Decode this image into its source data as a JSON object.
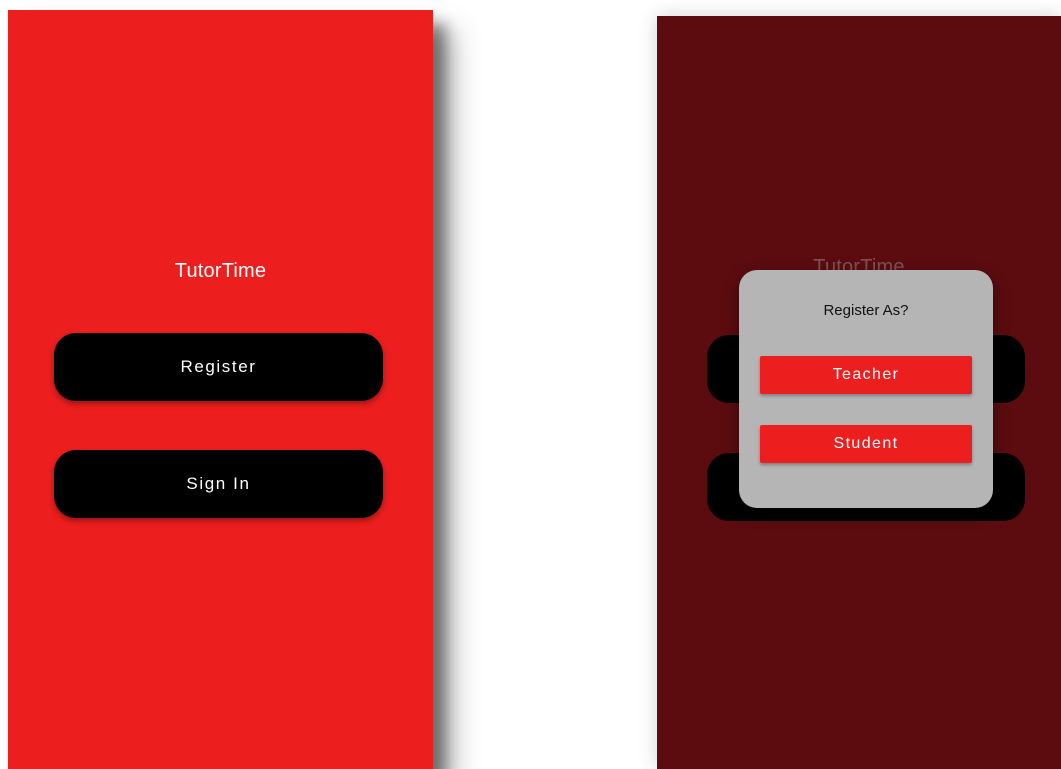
{
  "colors": {
    "primary_red": "#ed1e1e",
    "dimmed_red": "#5c0c0f",
    "button_black": "#000000",
    "dialog_grey": "#b5b5b5"
  },
  "left_screen": {
    "app_title": "TutorTime",
    "register_label": "Register",
    "signin_label": "Sign In"
  },
  "right_screen": {
    "app_title": "TutorTime",
    "dialog": {
      "title": "Register As?",
      "teacher_label": "Teacher",
      "student_label": "Student"
    }
  }
}
